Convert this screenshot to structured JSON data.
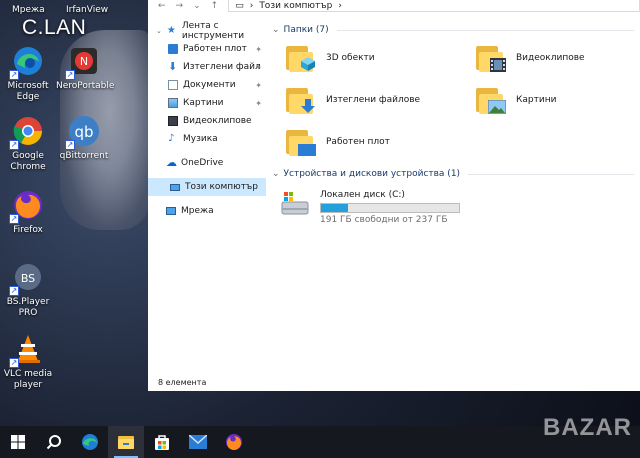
{
  "desktop": {
    "brand": "C.LAN",
    "top_labels": [
      "Мрежа",
      "IrfanView"
    ],
    "icons": [
      {
        "label": "Microsoft Edge",
        "icon": "edge-icon"
      },
      {
        "label": "NeroPortable",
        "icon": "nero-icon"
      },
      {
        "label": "Google Chrome",
        "icon": "chrome-icon"
      },
      {
        "label": "qBittorrent",
        "icon": "qbittorrent-icon"
      },
      {
        "label": "Firefox",
        "icon": "firefox-icon"
      },
      {
        "label": "BS.Player PRO",
        "icon": "bsplayer-icon"
      },
      {
        "label": "VLC media player",
        "icon": "vlc-icon"
      }
    ]
  },
  "explorer": {
    "address": "Този компютър",
    "nav": {
      "quick_access": "Лента с инструменти",
      "items": [
        {
          "label": "Работен плот",
          "pinned": true
        },
        {
          "label": "Изтеглени файл",
          "pinned": true
        },
        {
          "label": "Документи",
          "pinned": true
        },
        {
          "label": "Картини",
          "pinned": true
        },
        {
          "label": "Видеоклипове",
          "pinned": false
        },
        {
          "label": "Музика",
          "pinned": false
        }
      ],
      "onedrive": "OneDrive",
      "this_pc": "Този компютър",
      "network": "Мрежа"
    },
    "folders_header": "Папки (7)",
    "folders": [
      {
        "label": "3D обекти"
      },
      {
        "label": "Видеоклипове"
      },
      {
        "label": "Изтеглени файлове"
      },
      {
        "label": "Картини"
      },
      {
        "label": "Работен плот"
      }
    ],
    "devices_header": "Устройства и дискови устройства (1)",
    "drive": {
      "label": "Локален диск (C:)",
      "space": "191 ГБ свободни от 237 ГБ",
      "used_fraction": 0.194
    },
    "status": "8 елемента"
  },
  "taskbar": {
    "items": [
      "windows-start-icon",
      "search-icon",
      "edge-icon",
      "file-explorer-icon",
      "store-icon",
      "mail-icon",
      "firefox-icon"
    ]
  },
  "watermark": "BAZAR"
}
